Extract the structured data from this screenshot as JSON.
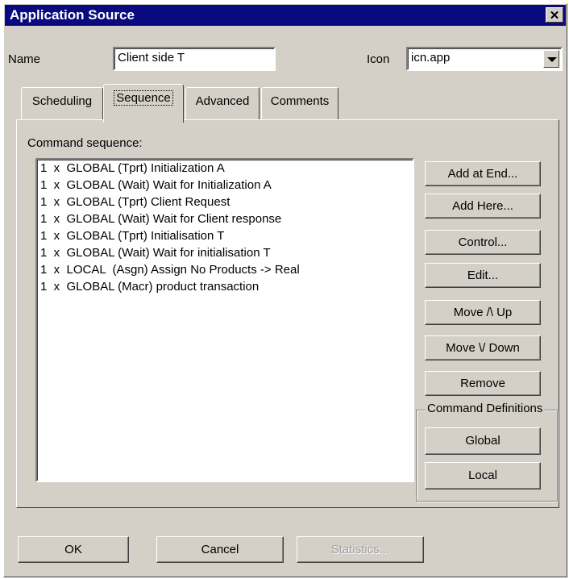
{
  "window": {
    "title": "Application Source",
    "close_glyph": "✕"
  },
  "form": {
    "name_label": "Name",
    "name_value": "Client side T",
    "icon_label": "Icon",
    "icon_value": "icn.app"
  },
  "tabs": [
    {
      "label": "Scheduling"
    },
    {
      "label": "Sequence"
    },
    {
      "label": "Advanced"
    },
    {
      "label": "Comments"
    }
  ],
  "sequence": {
    "label": "Command sequence:",
    "items": [
      "1  x  GLOBAL (Tprt) Initialization A",
      "1  x  GLOBAL (Wait) Wait for Initialization A",
      "1  x  GLOBAL (Tprt) Client Request",
      "1  x  GLOBAL (Wait) Wait for Client response",
      "1  x  GLOBAL (Tprt) Initialisation T",
      "1  x  GLOBAL (Wait) Wait for initialisation T",
      "1  x  LOCAL  (Asgn) Assign No Products -> Real",
      "1  x  GLOBAL (Macr) product transaction"
    ]
  },
  "side_buttons": {
    "add_at_end": "Add at End...",
    "add_here": "Add Here...",
    "control": "Control...",
    "edit": "Edit...",
    "move_up": "Move /\\ Up",
    "move_down": "Move \\/ Down",
    "remove": "Remove"
  },
  "command_definitions": {
    "title": "Command Definitions",
    "global": "Global",
    "local": "Local"
  },
  "footer": {
    "ok": "OK",
    "cancel": "Cancel",
    "statistics": "Statistics..."
  }
}
